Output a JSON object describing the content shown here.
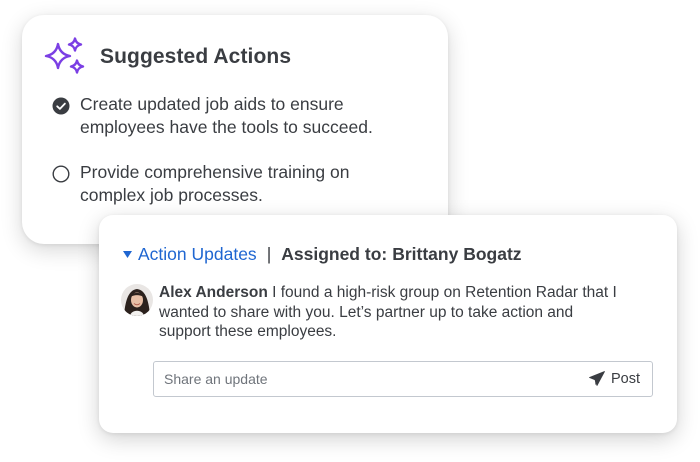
{
  "suggested_actions": {
    "title": "Suggested Actions",
    "icon": "sparkles-icon",
    "accent_color": "#7b3fe4",
    "items": [
      {
        "text": "Create updated job aids to ensure employees have the tools to succeed.",
        "checked": true
      },
      {
        "text": "Provide comprehensive training on complex job processes.",
        "checked": false
      }
    ]
  },
  "action_updates": {
    "title": "Action Updates",
    "separator": "|",
    "assigned_label": "Assigned to:",
    "assignee": "Brittany Bogatz",
    "link_color": "#1f66d1",
    "comment": {
      "author": "Alex Anderson",
      "text": "I found a high-risk group on Retention Radar that I wanted to share with you. Let’s partner up to take action and support these employees."
    },
    "update_input": {
      "placeholder": "Share an update",
      "value": ""
    },
    "post_label": "Post"
  }
}
